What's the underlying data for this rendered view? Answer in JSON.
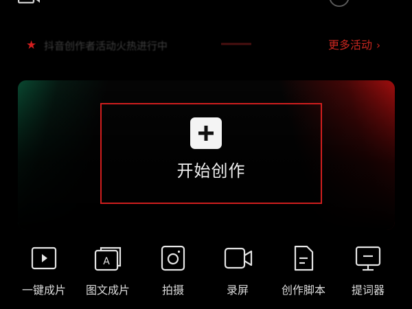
{
  "header": {
    "left_icon": "video-camera-icon",
    "right_icons": [
      "circle-icon",
      "shield-icon"
    ]
  },
  "banner": {
    "icon": "star-icon",
    "text": "抖音创作者活动火热进行中",
    "more_label": "更多活动",
    "more_icon": "chevron-right-icon",
    "accent_color": "#c8261f"
  },
  "hero": {
    "icon": "plus-icon",
    "label": "开始创作",
    "border_color": "#d11e1e"
  },
  "tools": [
    {
      "label": "一键成片",
      "icon": "play-video-icon"
    },
    {
      "label": "图文成片",
      "icon": "text-image-icon"
    },
    {
      "label": "拍摄",
      "icon": "camera-icon"
    },
    {
      "label": "录屏",
      "icon": "screen-record-icon"
    },
    {
      "label": "创作脚本",
      "icon": "script-document-icon"
    },
    {
      "label": "提词器",
      "icon": "teleprompter-icon"
    }
  ]
}
